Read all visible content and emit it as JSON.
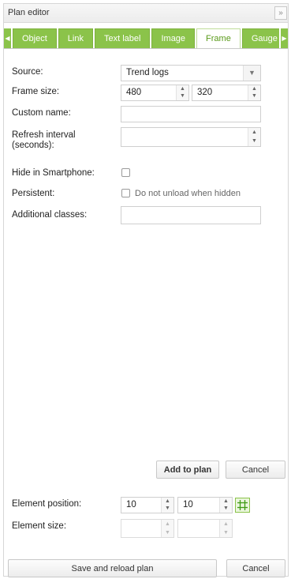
{
  "window": {
    "title": "Plan editor",
    "collapse_label": "»"
  },
  "tabs": [
    {
      "label": "Object"
    },
    {
      "label": "Link"
    },
    {
      "label": "Text label"
    },
    {
      "label": "Image"
    },
    {
      "label": "Frame"
    },
    {
      "label": "Gauge"
    }
  ],
  "form": {
    "source": {
      "label": "Source:",
      "value": "Trend logs"
    },
    "frame_size": {
      "label": "Frame size:",
      "width": "480",
      "height": "320"
    },
    "custom_name": {
      "label": "Custom name:",
      "value": ""
    },
    "refresh_interval": {
      "label": "Refresh interval (seconds):",
      "value": ""
    },
    "hide_in_smartphone": {
      "label": "Hide in Smartphone:",
      "checked": false
    },
    "persistent": {
      "label": "Persistent:",
      "checkbox_text": "Do not unload when hidden",
      "checked": false
    },
    "additional_classes": {
      "label": "Additional classes:",
      "value": ""
    }
  },
  "actions": {
    "add_to_plan": "Add to plan",
    "cancel": "Cancel"
  },
  "element": {
    "position_label": "Element position:",
    "position_x": "10",
    "position_y": "10",
    "size_label": "Element size:",
    "size_w": "",
    "size_h": ""
  },
  "footer": {
    "save_reload": "Save and reload plan",
    "cancel": "Cancel"
  },
  "colors": {
    "tab_green": "#8bc34a",
    "active_tab_text": "#5a9a1a"
  }
}
